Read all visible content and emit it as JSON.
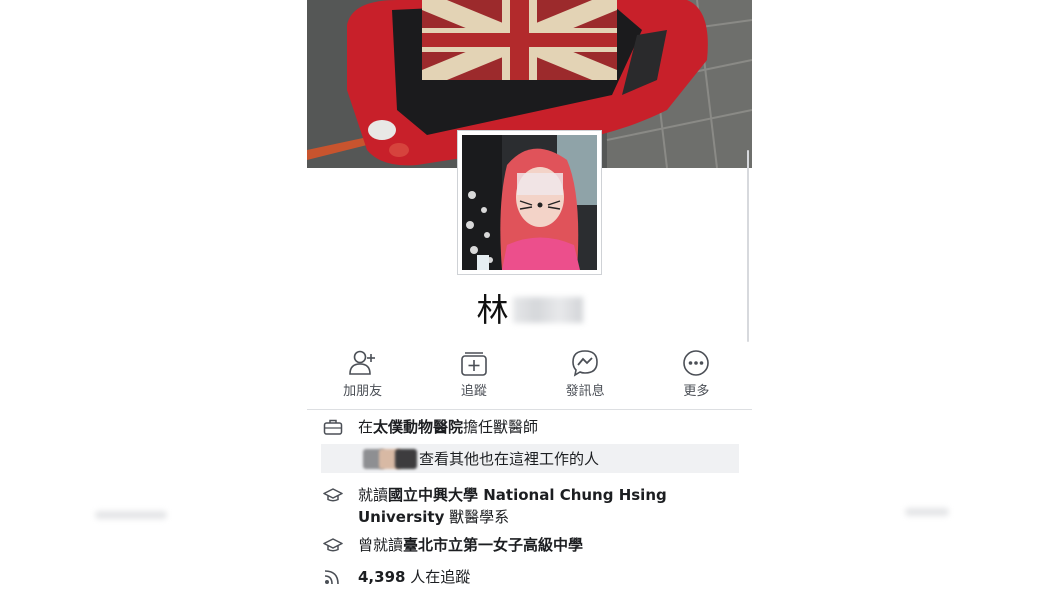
{
  "profile": {
    "name_visible": "林",
    "avatar_name": "profile-photo"
  },
  "actions": [
    {
      "label": "加朋友",
      "icon": "add-friend-icon"
    },
    {
      "label": "追蹤",
      "icon": "follow-icon"
    },
    {
      "label": "發訊息",
      "icon": "messenger-icon"
    },
    {
      "label": "更多",
      "icon": "more-icon"
    }
  ],
  "info": {
    "work": {
      "prefix": "在",
      "org": "太僕動物醫院",
      "suffix": "擔任獸醫師"
    },
    "coworkers_link": "查看其他也在這裡工作的人",
    "study": {
      "prefix": "就讀",
      "org_line1": "國立中興大學 National Chung Hsing",
      "org_line2": "University",
      "suffix": " 獸醫學系"
    },
    "studied": {
      "prefix": "曾就讀",
      "org": "臺北市立第一女子高級中學"
    },
    "followers": {
      "count": "4,398",
      "suffix": " 人在追蹤"
    }
  },
  "colors": {
    "car_red": "#c8202a",
    "hair": "#e0535a",
    "shirt": "#ec4f8c",
    "icon": "#4b4f56"
  }
}
